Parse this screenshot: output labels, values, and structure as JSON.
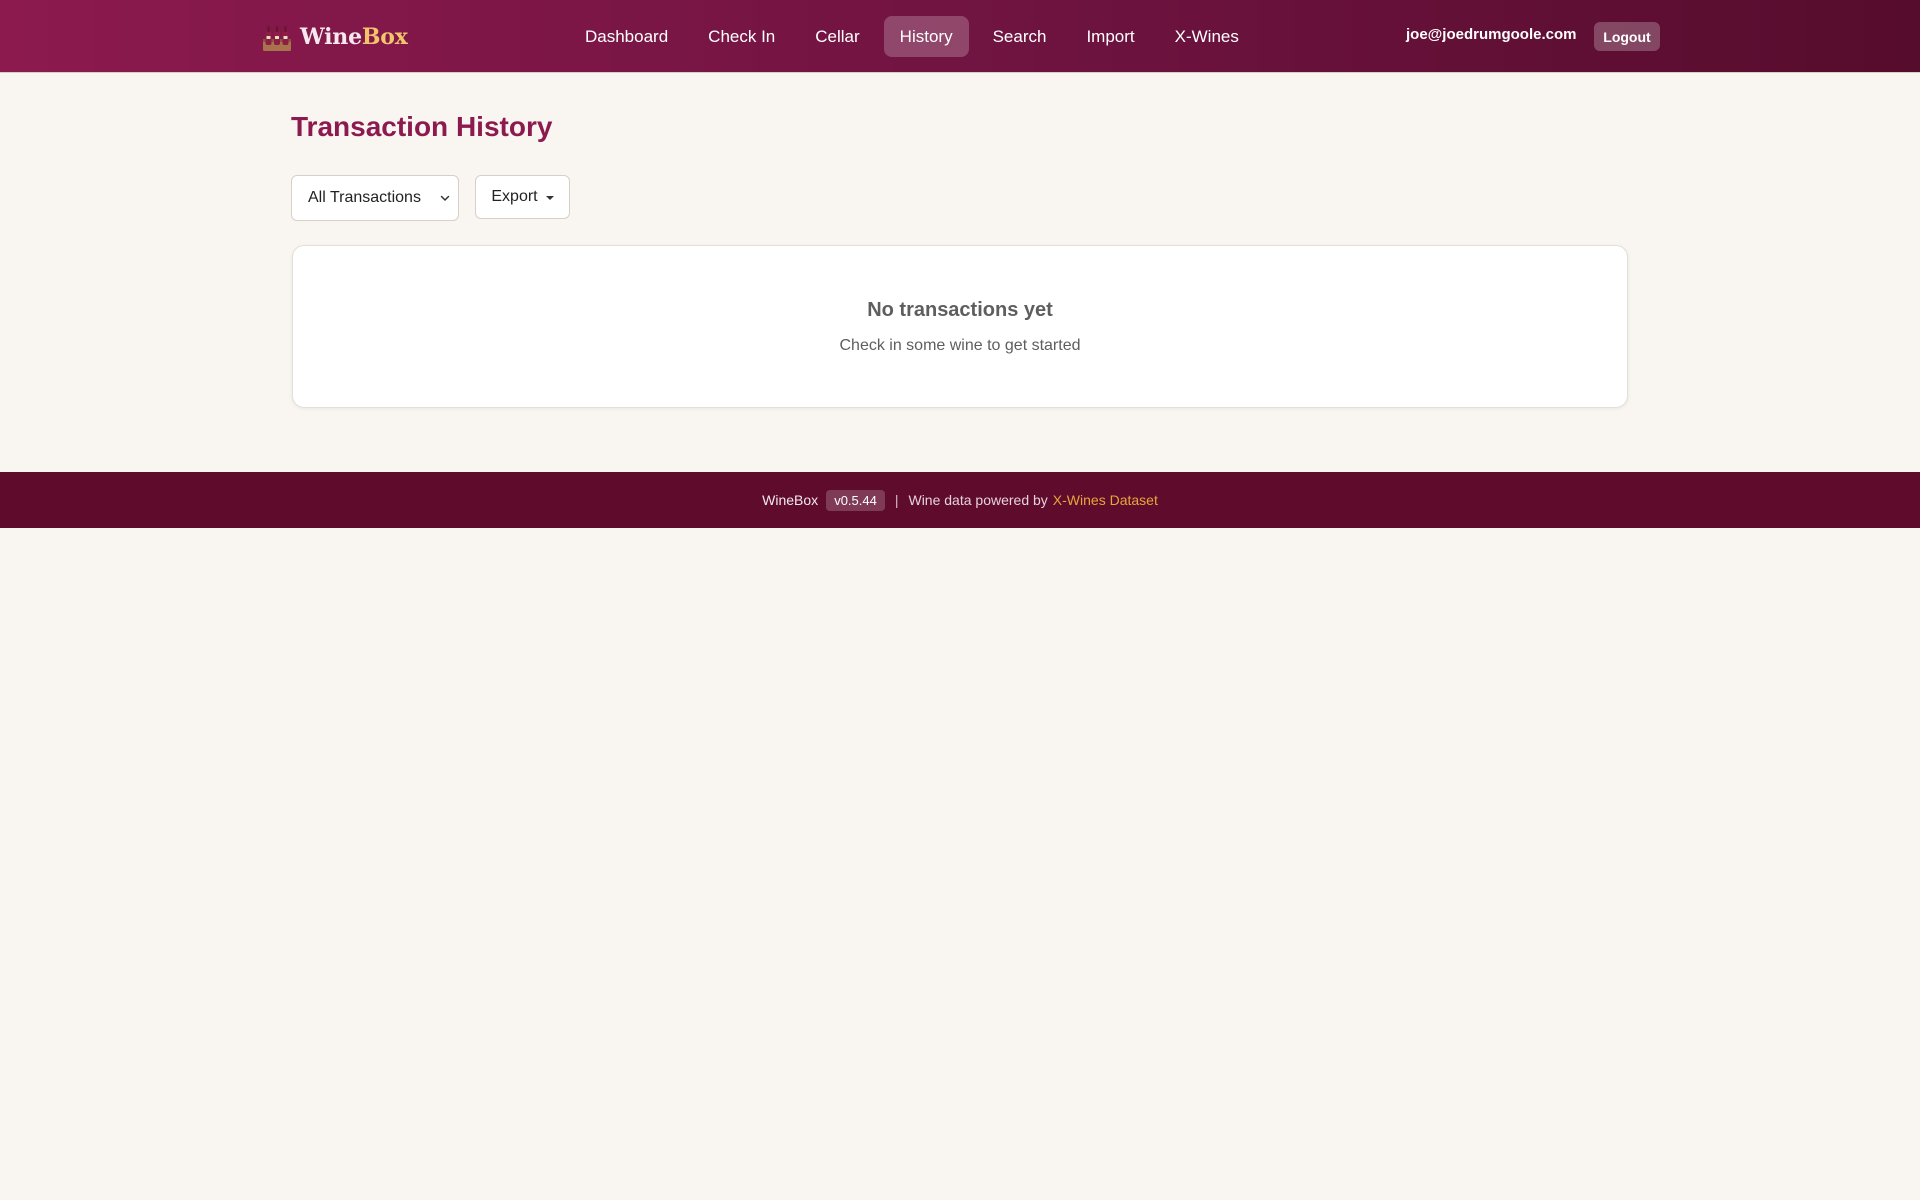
{
  "brand": {
    "name_part1": "Wine",
    "name_part2": "Box",
    "icon": "wine-bottles-icon"
  },
  "nav": {
    "items": [
      {
        "label": "Dashboard",
        "active": false
      },
      {
        "label": "Check In",
        "active": false
      },
      {
        "label": "Cellar",
        "active": false
      },
      {
        "label": "History",
        "active": true
      },
      {
        "label": "Search",
        "active": false
      },
      {
        "label": "Import",
        "active": false
      },
      {
        "label": "X-Wines",
        "active": false
      }
    ],
    "user_email": "joe@joedrumgoole.com",
    "logout_label": "Logout"
  },
  "page": {
    "title": "Transaction History",
    "filter": {
      "selected": "All Transactions",
      "icon": "chevron-down-icon"
    },
    "export_label": "Export",
    "empty_state": {
      "title": "No transactions yet",
      "subtitle": "Check in some wine to get started"
    }
  },
  "footer": {
    "app_name": "WineBox",
    "version": "v0.5.44",
    "separator": "|",
    "text": "Wine data powered by",
    "link_label": "X-Wines Dataset"
  },
  "colors": {
    "header_gradient_start": "#8c1a4e",
    "header_gradient_end": "#560c2c",
    "accent": "#8c1a4e",
    "brand_box": "#f2c46b",
    "footer_bg": "#5f0b2c",
    "footer_link": "#e8a63d",
    "page_bg": "#f9f6f1"
  }
}
